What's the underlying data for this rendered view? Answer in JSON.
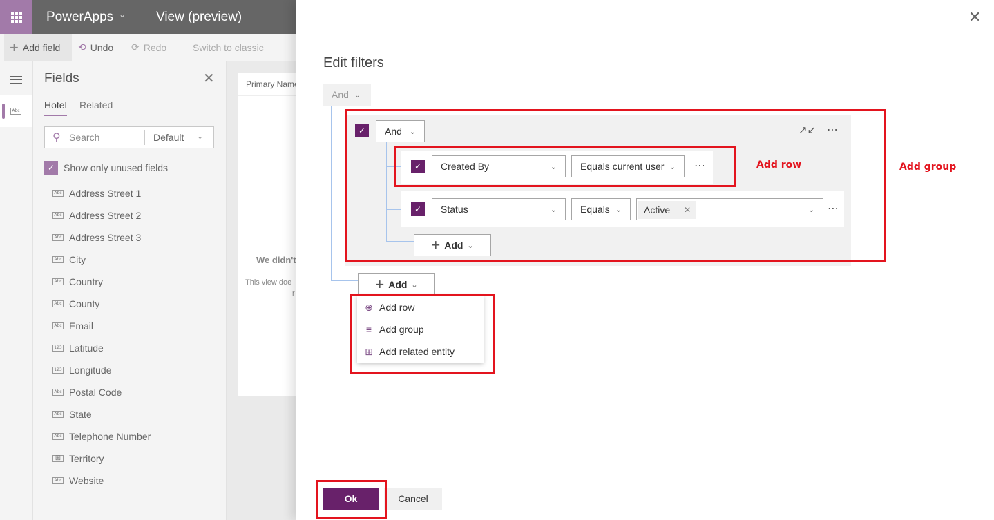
{
  "header": {
    "app_name": "PowerApps",
    "view_title": "View (preview)",
    "waffle_icon": "app-launcher-icon"
  },
  "toolbar": {
    "add_field": "Add field",
    "undo": "Undo",
    "redo": "Redo",
    "switch_classic": "Switch to classic"
  },
  "fields_panel": {
    "title": "Fields",
    "tabs": [
      {
        "label": "Hotel",
        "active": true
      },
      {
        "label": "Related",
        "active": false
      }
    ],
    "search_placeholder": "Search",
    "filter_select": "Default",
    "show_unused_label": "Show only unused fields",
    "show_unused_checked": true,
    "items": [
      {
        "label": "Address Street 1",
        "type": "text"
      },
      {
        "label": "Address Street 2",
        "type": "text"
      },
      {
        "label": "Address Street 3",
        "type": "text"
      },
      {
        "label": "City",
        "type": "text"
      },
      {
        "label": "Country",
        "type": "text"
      },
      {
        "label": "County",
        "type": "text"
      },
      {
        "label": "Email",
        "type": "text"
      },
      {
        "label": "Latitude",
        "type": "number"
      },
      {
        "label": "Longitude",
        "type": "number"
      },
      {
        "label": "Postal Code",
        "type": "text"
      },
      {
        "label": "State",
        "type": "text"
      },
      {
        "label": "Telephone Number",
        "type": "text"
      },
      {
        "label": "Territory",
        "type": "lookup"
      },
      {
        "label": "Website",
        "type": "text"
      }
    ]
  },
  "canvas": {
    "column_header": "Primary Name",
    "empty_title": "We didn't",
    "empty_desc": "This view doe",
    "empty_desc2": "r"
  },
  "dialog": {
    "title": "Edit filters",
    "root_operator": "And",
    "group": {
      "operator": "And",
      "checked": true,
      "rows": [
        {
          "field": "Created By",
          "operator": "Equals current user",
          "value": null,
          "checked": true
        },
        {
          "field": "Status",
          "operator": "Equals",
          "value": "Active",
          "checked": true
        }
      ],
      "add_label": "Add"
    },
    "add_label": "Add",
    "add_menu": [
      {
        "label": "Add row",
        "icon": "add-circle-icon"
      },
      {
        "label": "Add group",
        "icon": "group-lines-icon"
      },
      {
        "label": "Add related entity",
        "icon": "related-entity-icon"
      }
    ],
    "ok": "Ok",
    "cancel": "Cancel"
  },
  "annotations": {
    "add_row": "Add row",
    "add_group": "Add group",
    "color": "#e3141e"
  },
  "colors": {
    "brand": "#a27aa9",
    "primary": "#68216a",
    "connector": "#a7c4ec"
  }
}
